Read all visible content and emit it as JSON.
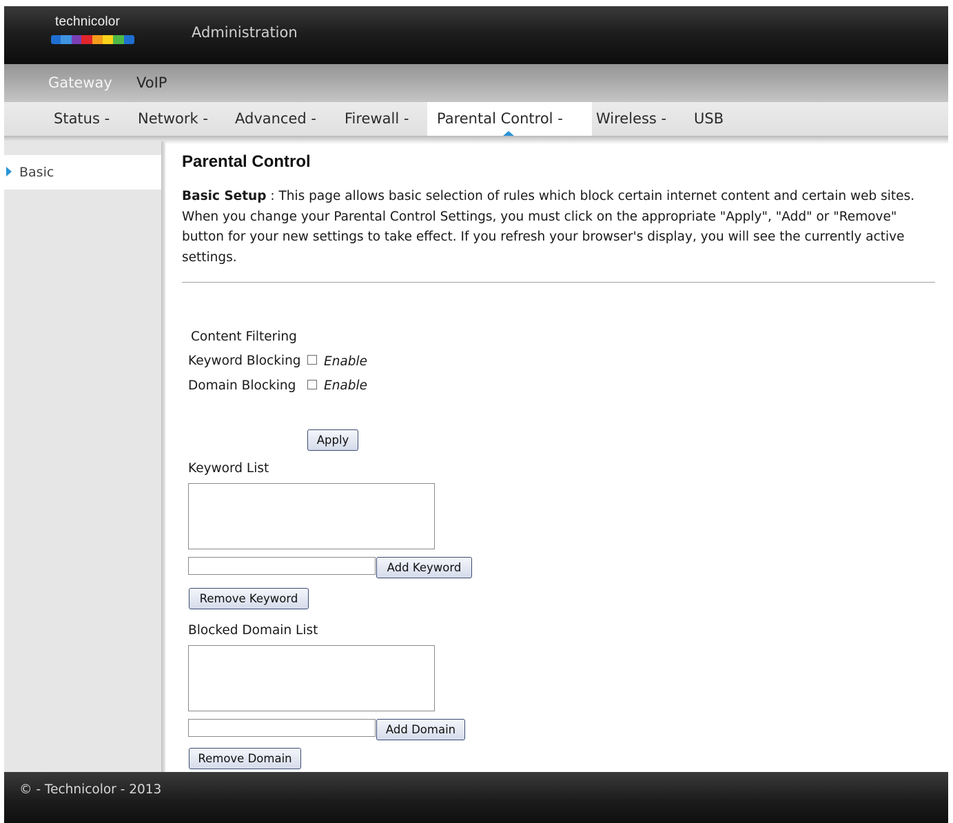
{
  "header": {
    "brand": "technicolor",
    "title": "Administration",
    "brand_colors": [
      "#1f6fd1",
      "#3f93e0",
      "#7b3fb5",
      "#e2242c",
      "#f39b1b",
      "#f9d21c",
      "#4eb847",
      "#1f6fd1"
    ]
  },
  "product_tabs": [
    {
      "label": "Gateway",
      "active": true
    },
    {
      "label": "VoIP",
      "active": false
    }
  ],
  "nav": {
    "items": [
      "Status -",
      "Network -",
      "Advanced -",
      "Firewall -",
      "Parental Control -",
      "Wireless -",
      "USB"
    ],
    "active": "Parental Control -"
  },
  "sidebar": {
    "items": [
      {
        "label": "Basic",
        "active": true
      }
    ]
  },
  "page": {
    "title": "Parental Control",
    "desc_label": "Basic Setup",
    "desc_sep": " : ",
    "desc_text": "This page allows basic selection of rules which block certain internet content and certain web sites. When you change your Parental Control Settings, you must click on the appropriate \"Apply\", \"Add\" or \"Remove\" button for your new settings to take effect. If you refresh your browser's display, you will see the currently active settings."
  },
  "filtering": {
    "heading": "Content Filtering",
    "keyword_label": "Keyword Blocking",
    "domain_label": "Domain Blocking",
    "enable_label": "Enable",
    "keyword_enabled": false,
    "domain_enabled": false,
    "apply_label": "Apply"
  },
  "keywords": {
    "heading": "Keyword List",
    "input_value": "",
    "add_label": "Add Keyword",
    "remove_label": "Remove Keyword"
  },
  "domains": {
    "heading": "Blocked Domain List",
    "input_value": "",
    "add_label": "Add Domain",
    "remove_label": "Remove Domain"
  },
  "footer": {
    "text": "© - Technicolor - 2013"
  },
  "colors": {
    "accent": "#2a94d6",
    "button_border": "#3c4c73"
  }
}
